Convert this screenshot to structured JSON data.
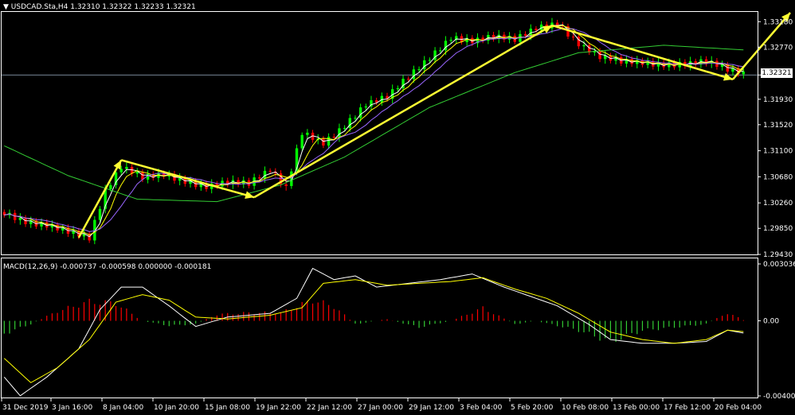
{
  "header": {
    "symbol_line": "USDCAD.Sta,H4  1.32310 1.32322 1.32233 1.32321",
    "macd_line": "MACD(12,26,9) -0.000737 -0.000598 0.000000 -0.000181"
  },
  "current_price": "1.32321",
  "colors": {
    "bull": "#00ff00",
    "bear": "#ff0000",
    "ma_fast": "#ffffff",
    "ma_mid": "#ffff00",
    "ma_purple": "#9966ff",
    "ma_slow": "#33cc33",
    "macd_line": "#ffffff",
    "signal_line": "#ffff00",
    "arrow": "#ffff33",
    "grid": "#ffffff"
  },
  "chart_data": [
    {
      "type": "candlestick",
      "title": "USDCAD.Sta,H4",
      "ylim": [
        1.2943,
        1.3335
      ],
      "y_ticks": [
        "1.33180",
        "1.32770",
        "1.32321",
        "1.31930",
        "1.31520",
        "1.31100",
        "1.30680",
        "1.30260",
        "1.29850",
        "1.29430"
      ],
      "x_ticks": [
        "31 Dec 2019",
        "3 Jan 16:00",
        "8 Jan 04:00",
        "10 Jan 20:00",
        "15 Jan 08:00",
        "19 Jan 22:00",
        "22 Jan 12:00",
        "27 Jan 00:00",
        "29 Jan 12:00",
        "3 Feb 04:00",
        "5 Feb 20:00",
        "10 Feb 08:00",
        "13 Feb 00:00",
        "17 Feb 12:00",
        "20 Feb 04:00"
      ],
      "price_path": [
        [
          0,
          1.301
        ],
        [
          4,
          1.2995
        ],
        [
          8,
          1.299
        ],
        [
          13,
          1.2978
        ],
        [
          16,
          1.297
        ],
        [
          19,
          1.3045
        ],
        [
          22,
          1.3085
        ],
        [
          26,
          1.3068
        ],
        [
          30,
          1.3072
        ],
        [
          34,
          1.306
        ],
        [
          38,
          1.3052
        ],
        [
          42,
          1.306
        ],
        [
          46,
          1.3058
        ],
        [
          50,
          1.308
        ],
        [
          53,
          1.305
        ],
        [
          56,
          1.314
        ],
        [
          60,
          1.3122
        ],
        [
          64,
          1.315
        ],
        [
          68,
          1.3185
        ],
        [
          72,
          1.3198
        ],
        [
          76,
          1.323
        ],
        [
          80,
          1.326
        ],
        [
          84,
          1.3292
        ],
        [
          88,
          1.3287
        ],
        [
          92,
          1.3295
        ],
        [
          96,
          1.329
        ],
        [
          100,
          1.3308
        ],
        [
          104,
          1.3315
        ],
        [
          108,
          1.3282
        ],
        [
          112,
          1.3262
        ],
        [
          116,
          1.3255
        ],
        [
          120,
          1.3252
        ],
        [
          124,
          1.3248
        ],
        [
          128,
          1.325
        ],
        [
          132,
          1.3255
        ],
        [
          136,
          1.3242
        ],
        [
          140,
          1.3232
        ]
      ],
      "price_wave": [
        0.0012,
        0.0009,
        0.0014,
        0.0008,
        0.0011,
        0.001,
        0.0015,
        0.0009,
        0.0012,
        0.0008
      ],
      "ma_fast_offset": 3,
      "ma_mid_offset": 5,
      "ma_purple_offset": 9,
      "ma_slow_path": [
        [
          0,
          1.3118
        ],
        [
          12,
          1.307
        ],
        [
          25,
          1.3032
        ],
        [
          40,
          1.3028
        ],
        [
          52,
          1.3055
        ],
        [
          64,
          1.31
        ],
        [
          80,
          1.318
        ],
        [
          96,
          1.3236
        ],
        [
          108,
          1.3268
        ],
        [
          124,
          1.328
        ],
        [
          140,
          1.3272
        ]
      ],
      "arrows": [
        {
          "from": [
            14,
            1.297
          ],
          "to": [
            22,
            1.3095
          ]
        },
        {
          "from": [
            22,
            1.3095
          ],
          "to": [
            47,
            1.3035
          ]
        },
        {
          "from": [
            47,
            1.3035
          ],
          "to": [
            103,
            1.3312
          ]
        },
        {
          "from": [
            103,
            1.3312
          ],
          "to": [
            137,
            1.3225
          ]
        },
        {
          "from": [
            137,
            1.3225
          ],
          "to": [
            152,
            1.3335
          ]
        }
      ]
    },
    {
      "type": "macd",
      "title": "MACD(12,26,9)",
      "ylim": [
        -0.004007,
        0.003036
      ],
      "y_ticks": [
        "0.003036",
        "0.00",
        "-0.004007"
      ],
      "histogram_path": [
        [
          0,
          -0.0008
        ],
        [
          5,
          -0.0002
        ],
        [
          10,
          0.0006
        ],
        [
          16,
          0.0012
        ],
        [
          21,
          0.0011
        ],
        [
          26,
          0.0
        ],
        [
          31,
          -0.0003
        ],
        [
          36,
          -0.0002
        ],
        [
          40,
          0.0004
        ],
        [
          46,
          0.0005
        ],
        [
          52,
          0.0005
        ],
        [
          58,
          0.0013
        ],
        [
          62,
          0.0009
        ],
        [
          66,
          -0.0002
        ],
        [
          72,
          0.0001
        ],
        [
          78,
          -0.0004
        ],
        [
          84,
          0.0
        ],
        [
          90,
          0.0008
        ],
        [
          96,
          -0.0002
        ],
        [
          100,
          0.0
        ],
        [
          108,
          -0.0006
        ],
        [
          114,
          -0.0013
        ],
        [
          120,
          -0.0006
        ],
        [
          126,
          -0.0004
        ],
        [
          132,
          -0.0002
        ],
        [
          136,
          0.0005
        ],
        [
          140,
          -0.0001
        ]
      ],
      "macd_path": [
        [
          0,
          -0.003
        ],
        [
          3,
          -0.004
        ],
        [
          8,
          -0.003
        ],
        [
          14,
          -0.0015
        ],
        [
          18,
          0.0006
        ],
        [
          22,
          0.0018
        ],
        [
          26,
          0.0018
        ],
        [
          31,
          0.0008
        ],
        [
          36,
          -0.0003
        ],
        [
          42,
          0.0002
        ],
        [
          50,
          0.0004
        ],
        [
          55,
          0.0012
        ],
        [
          58,
          0.0028
        ],
        [
          62,
          0.0022
        ],
        [
          66,
          0.0024
        ],
        [
          70,
          0.0018
        ],
        [
          76,
          0.002
        ],
        [
          82,
          0.0022
        ],
        [
          88,
          0.0025
        ],
        [
          94,
          0.0018
        ],
        [
          100,
          0.0012
        ],
        [
          104,
          0.0008
        ],
        [
          110,
          -0.0002
        ],
        [
          114,
          -0.001
        ],
        [
          120,
          -0.0012
        ],
        [
          126,
          -0.0012
        ],
        [
          132,
          -0.0011
        ],
        [
          136,
          -0.0005
        ],
        [
          140,
          -0.0007
        ]
      ],
      "signal_path": [
        [
          0,
          -0.002
        ],
        [
          5,
          -0.0033
        ],
        [
          10,
          -0.0025
        ],
        [
          16,
          -0.001
        ],
        [
          21,
          0.001
        ],
        [
          26,
          0.0014
        ],
        [
          31,
          0.0011
        ],
        [
          36,
          0.0002
        ],
        [
          42,
          0.0001
        ],
        [
          50,
          0.0003
        ],
        [
          56,
          0.0007
        ],
        [
          60,
          0.002
        ],
        [
          66,
          0.0022
        ],
        [
          72,
          0.0019
        ],
        [
          78,
          0.002
        ],
        [
          84,
          0.0021
        ],
        [
          90,
          0.0023
        ],
        [
          96,
          0.0017
        ],
        [
          102,
          0.0012
        ],
        [
          108,
          0.0004
        ],
        [
          114,
          -0.0006
        ],
        [
          120,
          -0.001
        ],
        [
          126,
          -0.0012
        ],
        [
          132,
          -0.001
        ],
        [
          136,
          -0.0005
        ],
        [
          140,
          -0.0006
        ]
      ]
    }
  ]
}
